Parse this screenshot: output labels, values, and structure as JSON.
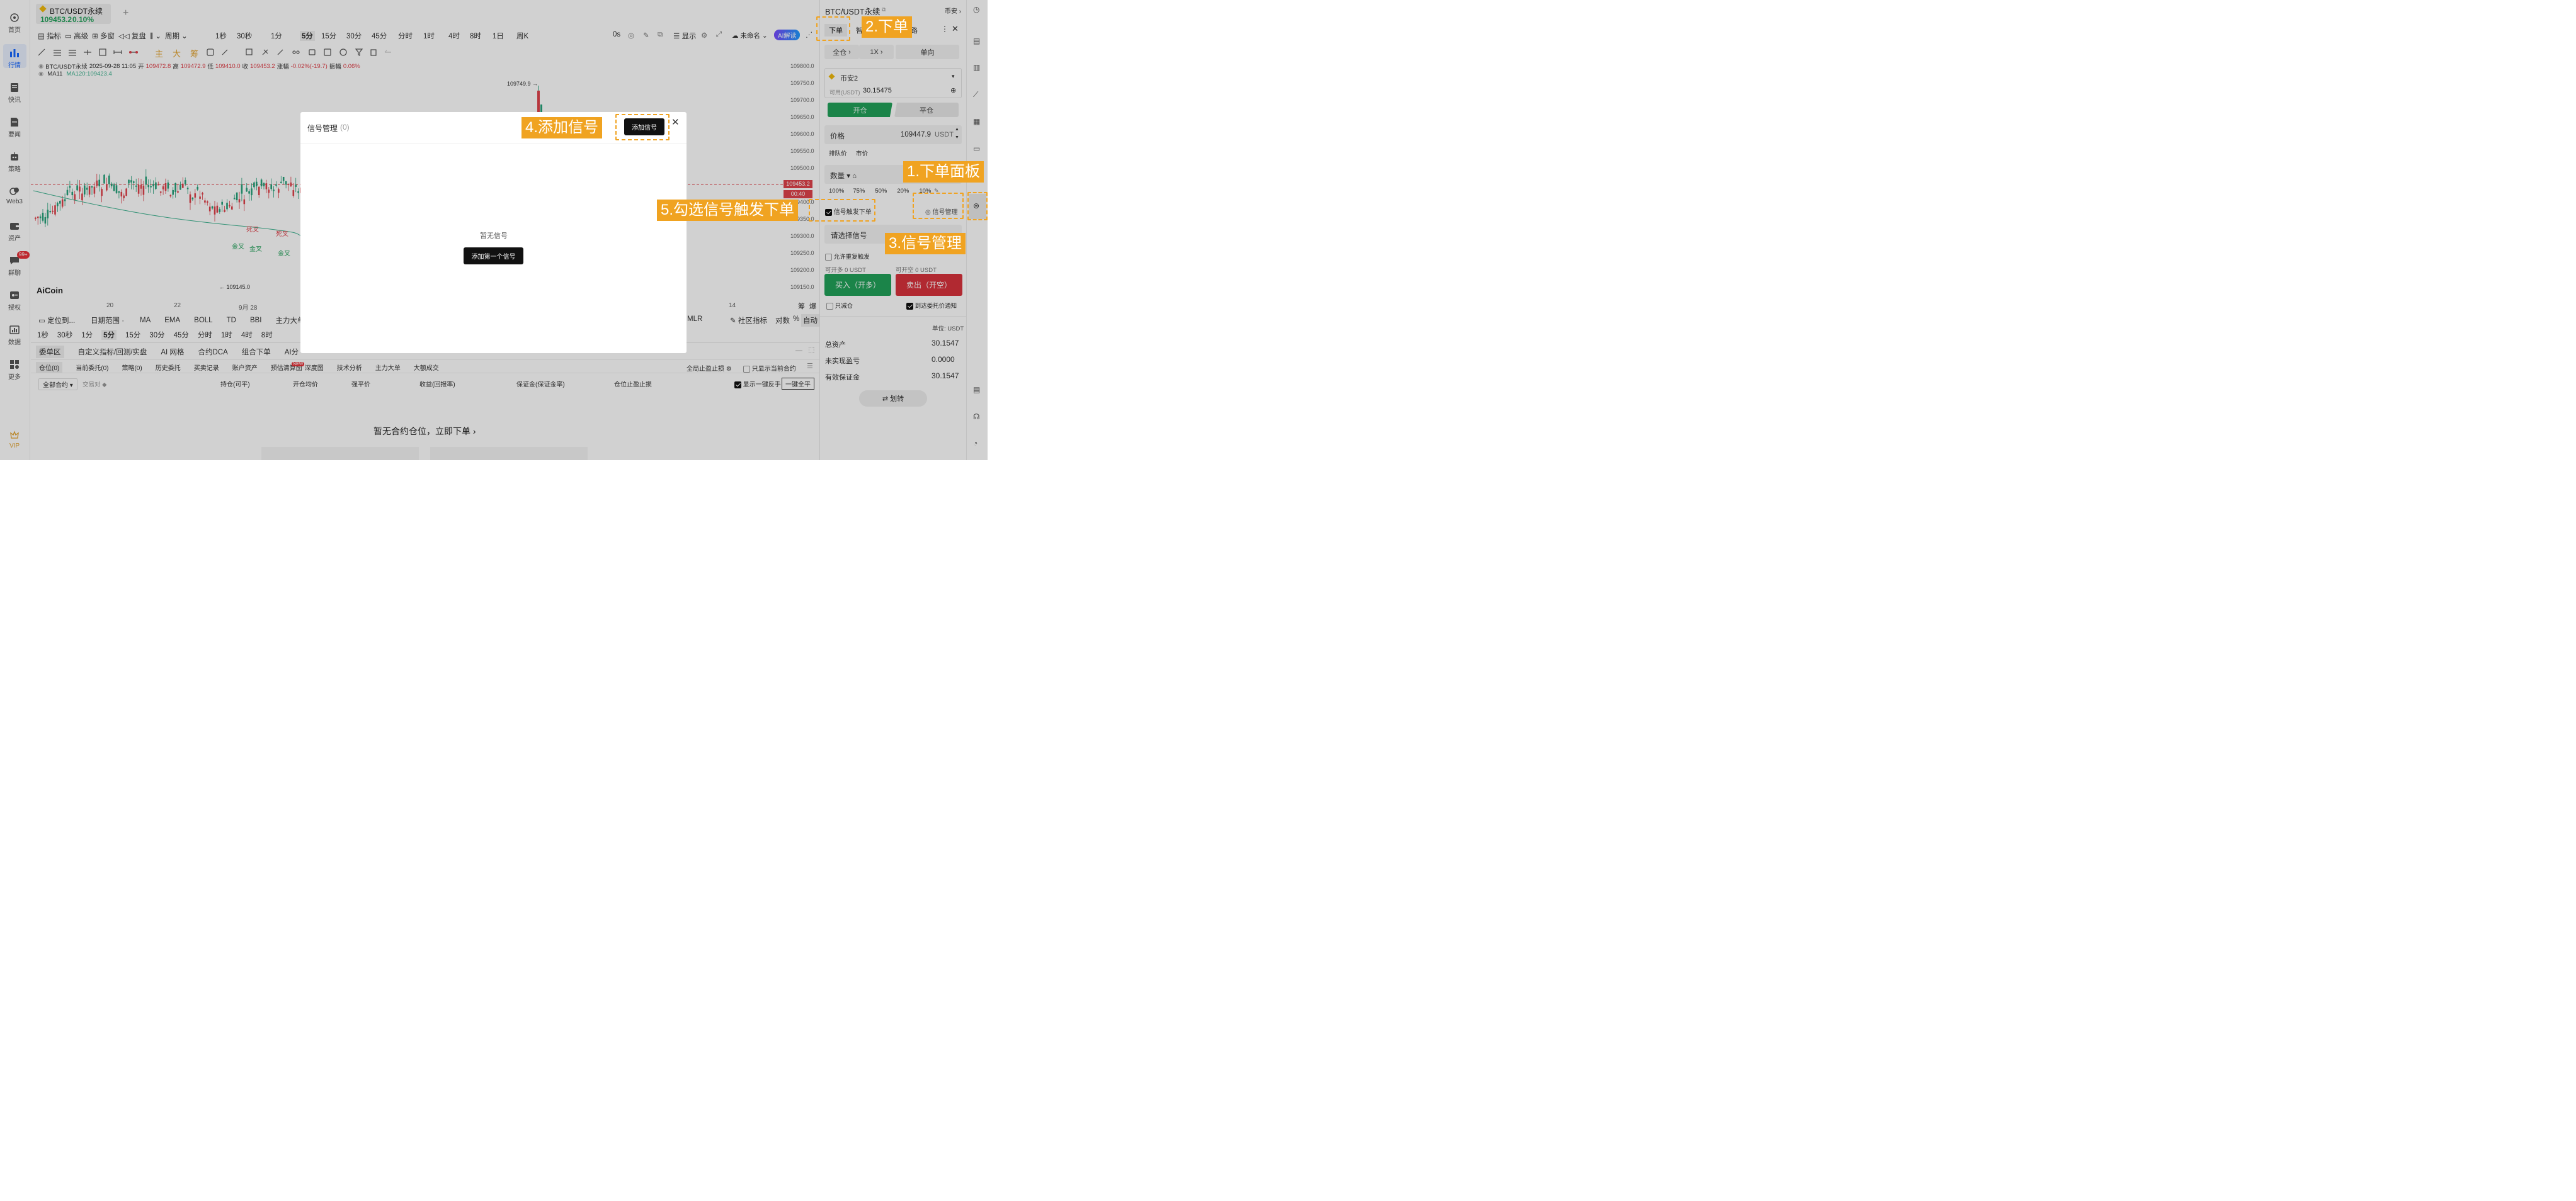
{
  "leftnav": {
    "items": [
      {
        "label": "首页",
        "icon": "home-icon"
      },
      {
        "label": "行情",
        "icon": "market-chart-icon"
      },
      {
        "label": "快讯",
        "icon": "news-flash-icon"
      },
      {
        "label": "要闻",
        "icon": "headlines-icon"
      },
      {
        "label": "策略",
        "icon": "robot-strategy-icon"
      },
      {
        "label": "Web3",
        "icon": "web3-icon"
      },
      {
        "label": "资产",
        "icon": "wallet-icon"
      },
      {
        "label": "群聊",
        "icon": "chat-icon"
      },
      {
        "label": "授权",
        "icon": "authorize-icon"
      },
      {
        "label": "数据",
        "icon": "data-icon"
      },
      {
        "label": "更多",
        "icon": "more-grid-icon"
      }
    ],
    "chat_badge": "99+",
    "vip_label": "VIP"
  },
  "tab": {
    "symbol": "BTC/USDT永续",
    "price": "109453.2",
    "change": "0.10%",
    "add": "+"
  },
  "toolbar1": {
    "items": [
      "指标",
      "高级",
      "多窗",
      "复盘"
    ],
    "period_label": "周期",
    "timeframes": [
      "1秒",
      "30秒",
      "1分",
      "5分",
      "15分",
      "30分",
      "45分",
      "分时",
      "1时",
      "4时",
      "8时",
      "1日",
      "周K"
    ],
    "active_tf": "5分",
    "countdown": "0s",
    "display": "显示",
    "layout_name": "未命名",
    "ai_label": "AI解读"
  },
  "drawbar": {
    "main": "主",
    "big": "大",
    "chip": "筹"
  },
  "chart": {
    "info_line": {
      "symbol": "BTC/USDT永续",
      "datetime": "2025-09-28 11:05",
      "open_label": "开",
      "open": "109472.8",
      "high_label": "高",
      "high": "109472.9",
      "low_label": "低",
      "low": "109410.0",
      "close_label": "收",
      "close": "109453.2",
      "chg_label": "涨幅",
      "chg": "-0.02%(-19.7)",
      "amp_label": "振幅",
      "amp": "0.06%"
    },
    "ma_line": {
      "name": "MA11",
      "ma120": "MA120:109423.4"
    },
    "price_axis": [
      "109800.0",
      "109750.0",
      "109700.0",
      "109650.0",
      "109600.0",
      "109550.0",
      "109500.0",
      "109400.0",
      "109350.0",
      "109300.0",
      "109250.0",
      "109200.0",
      "109150.0"
    ],
    "current_price": "109453.2",
    "countdown": "00:40",
    "high_marker": "109749.9 →",
    "low_marker": "← 109145.0",
    "time_axis": [
      "20",
      "22",
      "9月 28",
      "14"
    ],
    "signals": {
      "golden": "金叉",
      "death": "死叉"
    },
    "logo": "AiCoin",
    "chip_label": "筹",
    "explode_label": "爆"
  },
  "indbar": {
    "locate": "定位到...",
    "date_range": "日期范围",
    "indicators": [
      "MA",
      "EMA",
      "BOLL",
      "TD",
      "BBI",
      "主力大单距"
    ],
    "mlr": "MLR",
    "community": "社区指标",
    "log": "对数",
    "pct": "%",
    "auto": "自动"
  },
  "tfbar": {
    "items": [
      "1秒",
      "30秒",
      "1分",
      "5分",
      "15分",
      "30分",
      "45分",
      "分时",
      "1时",
      "4时",
      "8时"
    ],
    "active": "5分"
  },
  "panel": {
    "tabs": [
      "委单区",
      "自定义指标/回测/实盘",
      "AI 网格",
      "合约DCA",
      "组合下单",
      "AI分"
    ],
    "subtabs": [
      "仓位(0)",
      "当前委托(0)",
      "策略(0)",
      "历史委托",
      "买卖记录",
      "账户资产",
      "预估清算图",
      "深度图",
      "技术分析",
      "主力大单",
      "大额成交"
    ],
    "new_badge": "NEW",
    "global_tpsl": "全局止盈止损",
    "only_current": "只显示当前合约",
    "filter_all": "全部合约",
    "filter_pair": "交易对",
    "columns": [
      "持仓(可平)",
      "开仓均价",
      "强平价",
      "收益(回报率)",
      "保证金(保证金率)",
      "仓位止盈止损"
    ],
    "show_reverse": "显示一键反手",
    "close_all": "一键全平",
    "empty": "暂无合约仓位，立即下单"
  },
  "rpanel": {
    "title": "BTC/USDT永续",
    "exchange": "币安",
    "tab_order": "下单",
    "tab_smart": "智",
    "tab_extra": "路",
    "cross": "全仓",
    "leverage": "1X",
    "mode": "单向",
    "account": "币安2",
    "available_label": "可用(USDT)",
    "available": "30.15475",
    "open": "开仓",
    "close": "平仓",
    "price_label": "价格",
    "price": "109447.9",
    "unit": "USDT",
    "queue": "排队价",
    "market": "市价",
    "qty_label": "数量",
    "pcts": [
      "100%",
      "75%",
      "50%",
      "20%",
      "10%"
    ],
    "signal_trigger": "信号触发下单",
    "signal_manage": "信号管理",
    "select_signal": "请选择信号",
    "allow_repeat": "允许重复触发",
    "can_long": "可开多 0 USDT",
    "can_short": "可开空 0 USDT",
    "buy": "买入（开多）",
    "sell": "卖出（开空）",
    "reduce_only": "只减仓",
    "notify": "到达委托价通知",
    "unit_label": "单位: USDT",
    "total_label": "总资产",
    "total": "30.1547",
    "unreal_label": "未实现盈亏",
    "unreal": "0.0000",
    "margin_label": "有效保证金",
    "margin": "30.1547",
    "transfer": "划转"
  },
  "modal": {
    "title": "信号管理",
    "count": "(0)",
    "add_button": "添加信号",
    "empty": "暂无信号",
    "add_first": "添加第一个信号"
  },
  "annotations": {
    "a1": "1.下单面板",
    "a2": "2.下单",
    "a3": "3.信号管理",
    "a4": "4.添加信号",
    "a5": "5.勾选信号触发下单"
  },
  "colors": {
    "up": "#26a17b",
    "down": "#e0424b",
    "ma": "#3bb18e",
    "accent": "#f0a321",
    "blue": "#1667ff",
    "buy": "#21a15a",
    "sell": "#d8333c"
  }
}
